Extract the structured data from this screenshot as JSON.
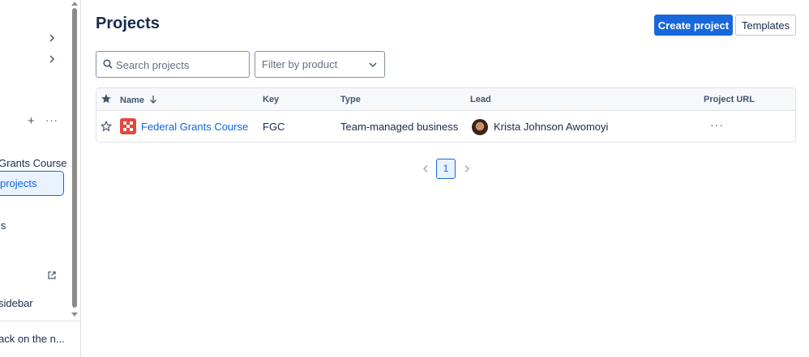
{
  "sidebar": {
    "items": [
      {
        "label": "Grants Course"
      },
      {
        "label": "projects",
        "selected": true
      },
      {
        "label": "ls"
      },
      {
        "label": "sidebar"
      }
    ],
    "footer_label": "ack on the n..."
  },
  "header": {
    "title": "Projects",
    "create_button": "Create project",
    "templates_button": "Templates"
  },
  "filters": {
    "search_placeholder": "Search projects",
    "product_filter_label": "Filter by product"
  },
  "table": {
    "columns": [
      "Name",
      "Key",
      "Type",
      "Lead",
      "Project URL"
    ],
    "rows": [
      {
        "name": "Federal Grants Course",
        "key": "FGC",
        "type": "Team-managed business",
        "lead": "Krista Johnson Awomoyi",
        "more": "···"
      }
    ]
  },
  "pagination": {
    "current_page": "1"
  },
  "colors": {
    "primary": "#1868db",
    "project_icon": "#e2483d"
  }
}
